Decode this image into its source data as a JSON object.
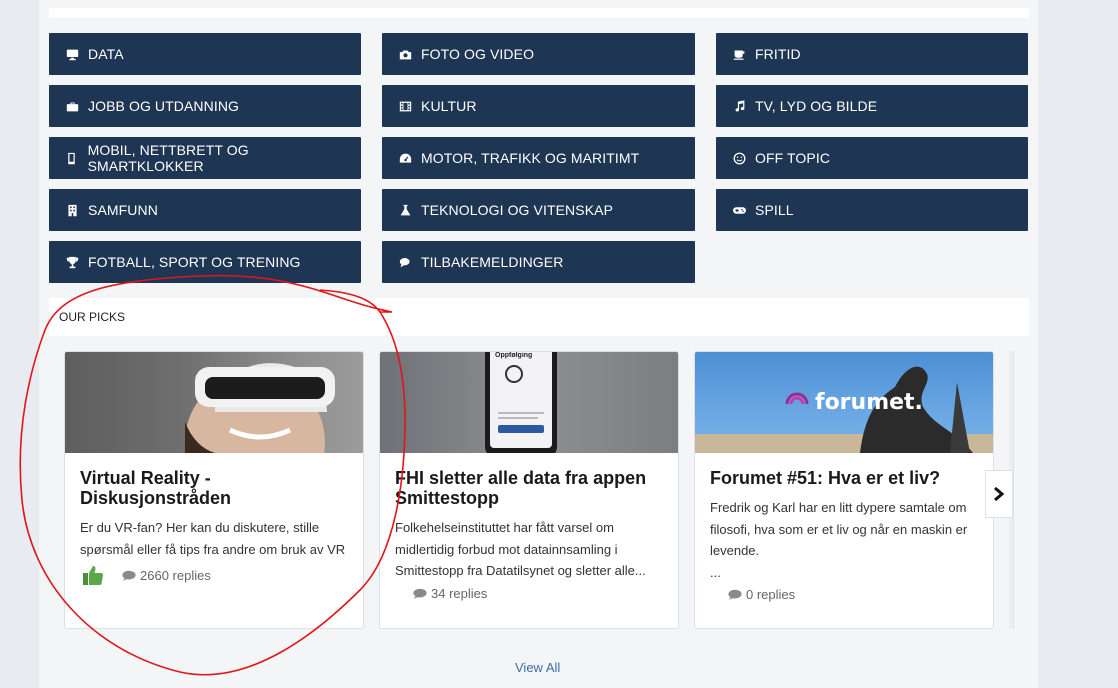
{
  "categories": [
    {
      "label": "DATA",
      "icon": "monitor-icon"
    },
    {
      "label": "FOTO OG VIDEO",
      "icon": "camera-icon"
    },
    {
      "label": "FRITID",
      "icon": "coffee-icon"
    },
    {
      "label": "JOBB OG UTDANNING",
      "icon": "briefcase-icon"
    },
    {
      "label": "KULTUR",
      "icon": "film-icon"
    },
    {
      "label": "TV, LYD OG BILDE",
      "icon": "music-icon"
    },
    {
      "label": "MOBIL, NETTBRETT OG SMARTKLOKKER",
      "icon": "mobile-icon"
    },
    {
      "label": "MOTOR, TRAFIKK OG MARITIMT",
      "icon": "dashboard-icon"
    },
    {
      "label": "OFF TOPIC",
      "icon": "smile-icon"
    },
    {
      "label": "SAMFUNN",
      "icon": "building-icon"
    },
    {
      "label": "TEKNOLOGI OG VITENSKAP",
      "icon": "flask-icon"
    },
    {
      "label": "SPILL",
      "icon": "gamepad-icon"
    },
    {
      "label": "FOTBALL, SPORT OG TRENING",
      "icon": "trophy-icon"
    },
    {
      "label": "TILBAKEMELDINGER",
      "icon": "comments-icon"
    }
  ],
  "picks": {
    "heading": "OUR PICKS",
    "cards": [
      {
        "title": "Virtual Reality - Diskusjonstråden",
        "description": "Er du VR-fan? Her kan du diskutere, stille spørsmål eller få tips fra andre om bruk av VR",
        "replies": "2660 replies"
      },
      {
        "title": "FHI sletter alle data fra appen Smittestopp",
        "description": "Folkehelseinstituttet har fått varsel om midlertidig forbud mot datainnsamling i Smittestopp fra Datatilsynet og sletter alle...",
        "replies": "34 replies"
      },
      {
        "title": "Forumet #51: Hva er et liv?",
        "description": "Fredrik og Karl har en litt dypere samtale om filosofi, hva som er et liv og når en maskin er levende.",
        "ellipsis": "...",
        "replies": "0 replies",
        "logo_text": "forumet."
      }
    ],
    "phone_text": "Oppfølging",
    "view_all": "View All"
  },
  "colors": {
    "tile_bg": "#1f3554",
    "link": "#3a6fa5",
    "annotation": "#e0161b"
  }
}
